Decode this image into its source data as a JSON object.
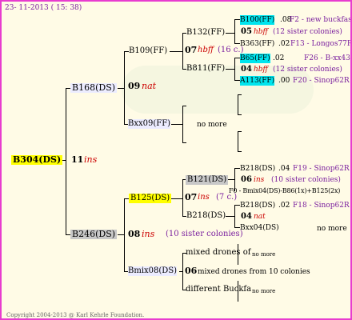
{
  "header": {
    "timestamp": "23- 11-2013 ( 15: 38)"
  },
  "footer": {
    "copyright": "Copyright 2004-2013 @ Karl Kehrle Foundation."
  },
  "root": {
    "id": "B304(DS)",
    "number": "11",
    "breed": "ins"
  },
  "gen1": {
    "top": {
      "id": "B168(DS)",
      "number": "09",
      "breed": "nat"
    },
    "bottom": {
      "id": "B246(DS)",
      "number": "08",
      "breed": "ins",
      "siblings": "(10 sister colonies)"
    }
  },
  "gen2": {
    "b109": {
      "id": "B109(FF)",
      "number": "07",
      "breed": "hbff",
      "siblings": "(16 c.)"
    },
    "bxx09": {
      "id": "Bxx09(FF)",
      "note": "no more"
    },
    "b125": {
      "id": "B125(DS)",
      "number": "07",
      "breed": "ins",
      "siblings": "(7 c.)"
    },
    "bmix08": {
      "id": "Bmix08(DS)",
      "number": "06",
      "note": "mixed drones from 10 colonies"
    }
  },
  "gen3": {
    "b132": {
      "id": "B132(FF)",
      "number": "05",
      "breed": "hbff",
      "siblings": "(12 sister colonies)"
    },
    "b811": {
      "id": "B811(FF)",
      "number": "04",
      "breed": "hbff",
      "siblings": "(12 sister colonies)"
    },
    "b121": {
      "id": "B121(DS)",
      "number": "06",
      "breed": "ins",
      "siblings": "(10 sister colonies)"
    },
    "b218": {
      "id": "B218(DS)",
      "number": "04",
      "breed": "nat"
    },
    "mixed": {
      "label": "mixed drones of",
      "note": "no more"
    },
    "different": {
      "label": "different Buckfa",
      "note": "no more"
    },
    "f0": {
      "label": "F0 - Bmix04(DS)-B86(1x)+B125(2x)"
    }
  },
  "gen4": {
    "b100": {
      "id": "B100(FF)",
      "year": ".08",
      "text": "F2 - new buckfast"
    },
    "b363": {
      "id": "B363(FF)",
      "year": ".02",
      "text": "F13 - Longos77R"
    },
    "b65": {
      "id": "B65(FF)",
      "year": ".02",
      "text": "F26 - B-xx43"
    },
    "a113": {
      "id": "A113(FF)",
      "year": ".00",
      "text": "F20 - Sinop62R"
    },
    "b218a": {
      "id": "B218(DS)",
      "year": ".04",
      "text": "F19 - Sinop62R"
    },
    "b218b": {
      "id": "B218(DS)",
      "year": ".02",
      "text": "F18 - Sinop62R"
    },
    "bxx04": {
      "id": "Bxx04(DS)",
      "note": "no more"
    }
  }
}
